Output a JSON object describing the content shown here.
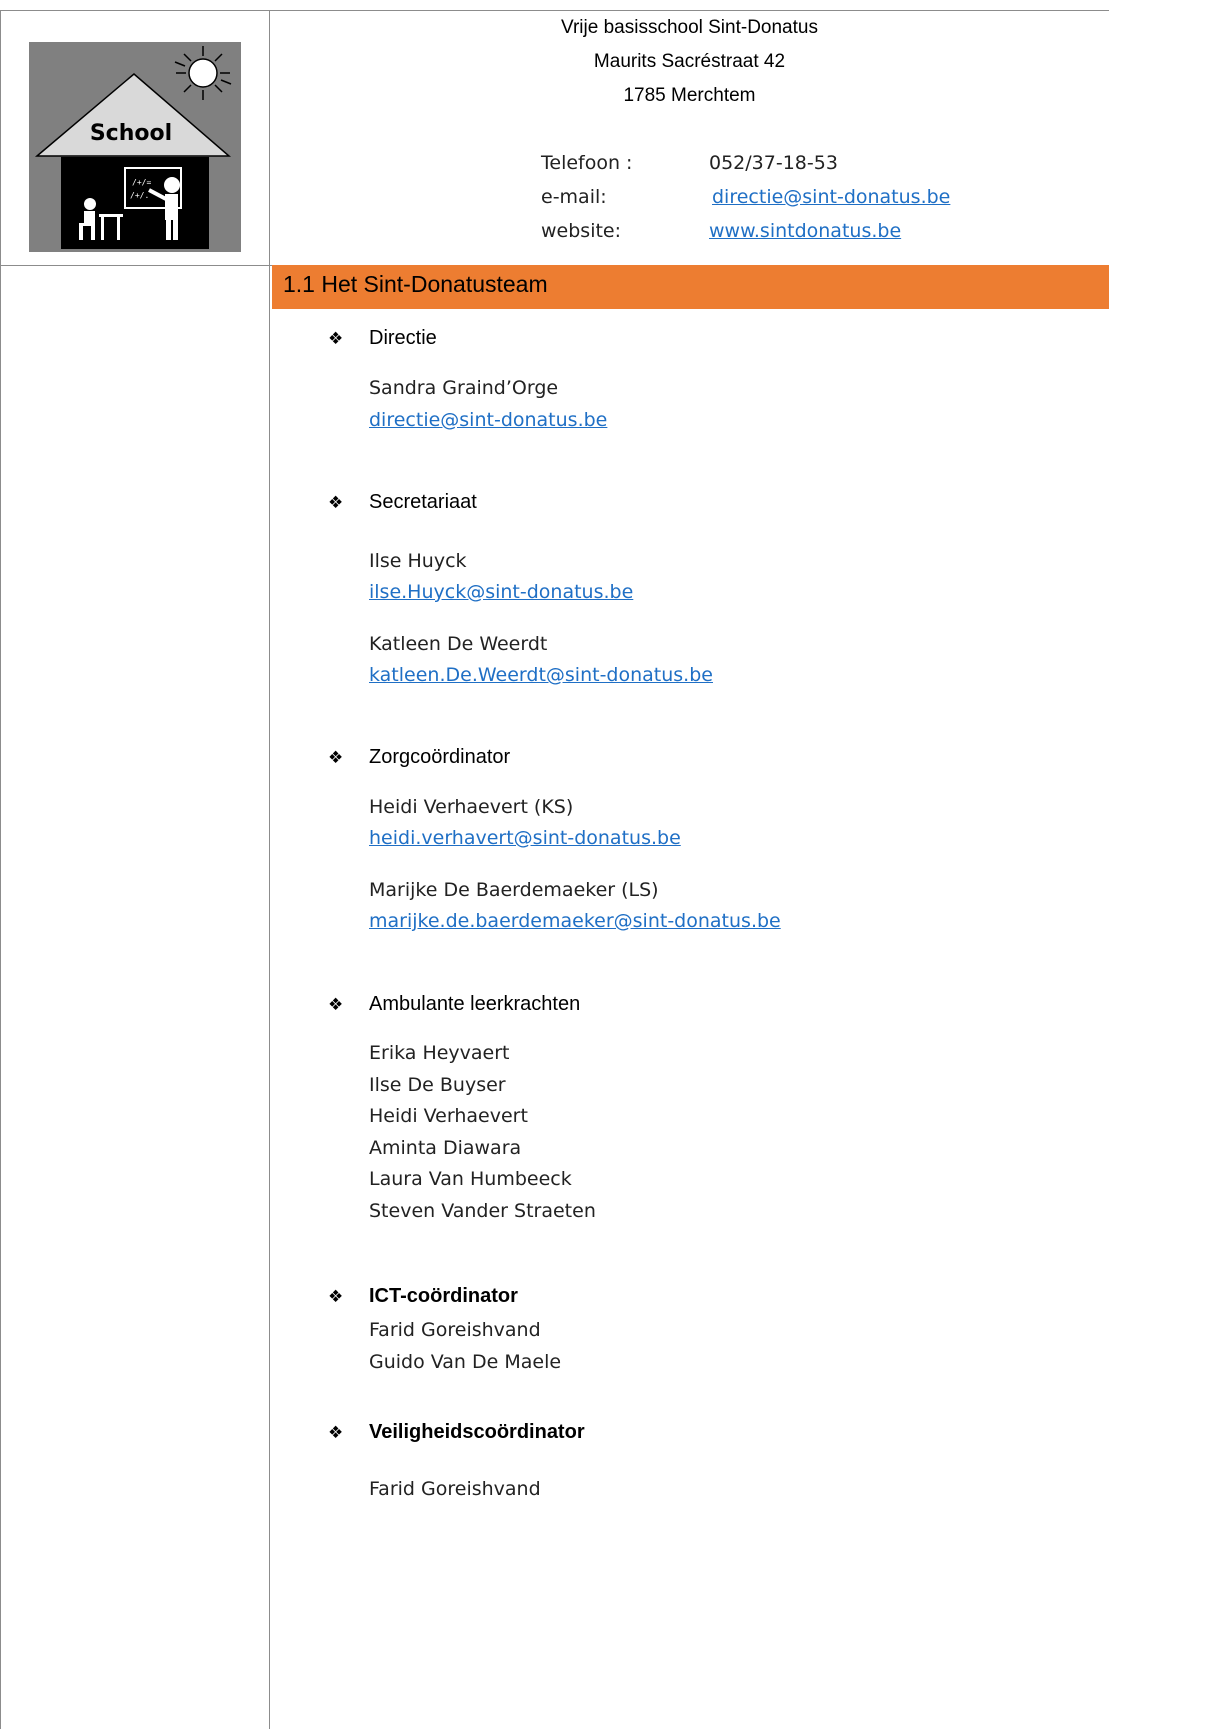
{
  "school": {
    "logo_label": "School",
    "name": "Vrije basisschool Sint-Donatus",
    "street": "Maurits Sacréstraat 42",
    "city": "1785 Merchtem"
  },
  "contact": [
    {
      "label": "Telefoon :",
      "value": "052/37-18-53"
    },
    {
      "label": "e-mail:",
      "value": "directie@sint-donatus.be"
    },
    {
      "label": "website:",
      "value": "www.sintdonatus.be"
    }
  ],
  "section_title": "1.1 Het Sint-Donatusteam",
  "bullet_glyph": "❖",
  "groups": {
    "directie": {
      "heading": "Directie",
      "lines": [
        "Sandra Graind’Orge",
        "directie@sint-donatus.be"
      ]
    },
    "secretariaat": {
      "heading": "Secretariaat",
      "lines": [
        "Ilse Huyck",
        "ilse.Huyck@sint-donatus.be",
        "Katleen De Weerdt",
        "katleen.De.Weerdt@sint-donatus.be"
      ]
    },
    "zorg": {
      "heading": "Zorgcoördinator",
      "lines": [
        "Heidi Verhaevert (KS)",
        "heidi.verhavert@sint-donatus.be",
        "Marijke De Baerdemaeker (LS)",
        "marijke.de.baerdemaeker@sint-donatus.be"
      ]
    },
    "ambulant": {
      "heading": "Ambulante leerkrachten",
      "lines": [
        "Erika Heyvaert",
        "Ilse De Buyser",
        "Heidi Verhaevert",
        "Aminta Diawara",
        "Laura Van Humbeeck",
        "Steven Vander Straeten"
      ]
    },
    "ict": {
      "heading": "ICT-coördinator",
      "lines": [
        "Farid Goreishvand",
        "Guido Van De Maele"
      ]
    },
    "veiligheid": {
      "heading": "Veiligheidscoördinator",
      "lines": [
        "Farid Goreishvand"
      ]
    }
  }
}
